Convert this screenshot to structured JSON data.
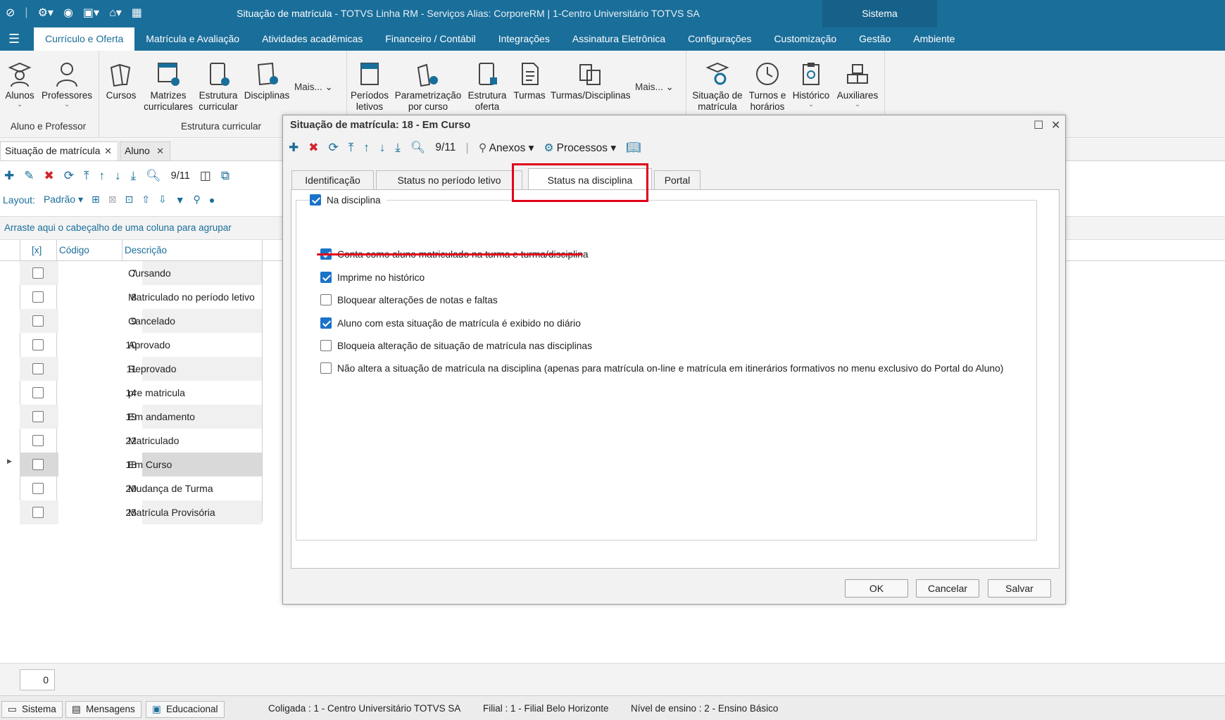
{
  "titlebar": {
    "title_main": "Situação de matrícula",
    "title_rest": " - TOTVS Linha RM - Serviços  Alias: CorporeRM | 1-Centro Universitário TOTVS SA",
    "sistema": "Sistema"
  },
  "menu": {
    "tabs": [
      "Currículo e Oferta",
      "Matrícula e Avaliação",
      "Atividades acadêmicas",
      "Financeiro / Contábil",
      "Integrações",
      "Assinatura Eletrônica",
      "Configurações",
      "Customização",
      "Gestão",
      "Ambiente"
    ]
  },
  "ribbon": {
    "alunos": "Alunos",
    "professores": "Professores",
    "cursos": "Cursos",
    "matrizes": "Matrizes curriculares",
    "estrutura_curricular": "Estrutura curricular",
    "disciplinas": "Disciplinas",
    "mais1": "Mais...",
    "periodos": "Períodos letivos",
    "parametrizacao": "Parametrização por curso",
    "estrutura_oferta": "Estrutura oferta",
    "turmas": "Turmas",
    "turmas_disciplinas": "Turmas/Disciplinas",
    "mais2": "Mais...",
    "situacao": "Situação de matrícula",
    "turnos": "Turnos e horários",
    "historico": "Histórico",
    "auxiliares": "Auxiliares",
    "group1": "Aluno e Professor",
    "group2": "Estrutura curricular"
  },
  "doctabs": {
    "tab1": "Situação de matrícula",
    "tab2": "Aluno"
  },
  "lefttoolbar": {
    "counter": "9/11",
    "layout_label": "Layout:",
    "layout_value": "Padrão"
  },
  "groupbar": {
    "text": "Arraste aqui o cabeçalho de uma coluna para agrupar"
  },
  "grid": {
    "headers": {
      "check": "[x]",
      "code": "Código",
      "desc": "Descrição"
    },
    "rows": [
      {
        "code": "7",
        "desc": "Cursando"
      },
      {
        "code": "8",
        "desc": "Matriculado no período letivo"
      },
      {
        "code": "9",
        "desc": "Cancelado"
      },
      {
        "code": "10",
        "desc": "Aprovado"
      },
      {
        "code": "11",
        "desc": "Reprovado"
      },
      {
        "code": "14",
        "desc": "pre matricula"
      },
      {
        "code": "19",
        "desc": "Em andamento"
      },
      {
        "code": "22",
        "desc": "Matriculado"
      },
      {
        "code": "18",
        "desc": "Em Curso"
      },
      {
        "code": "20",
        "desc": "Mudança de Turma"
      },
      {
        "code": "25",
        "desc": "Matrícula Provisória"
      }
    ]
  },
  "pager": {
    "value": "0"
  },
  "statusbar": {
    "sistema": "Sistema",
    "mensagens": "Mensagens",
    "educacional": "Educacional",
    "coligada": "Coligada : 1 - Centro Universitário TOTVS SA",
    "filial": "Filial : 1 - Filial Belo Horizonte",
    "nivel": "Nível de ensino : 2 - Ensino Básico"
  },
  "dialog": {
    "title": "Situação de matrícula: 18 - Em Curso",
    "counter": "9/11",
    "anexos": "Anexos",
    "processos": "Processos",
    "tabs": [
      "Identificação",
      "Status no período letivo",
      "Status na disciplina",
      "Portal"
    ],
    "fieldset_label": "Na disciplina",
    "options": [
      {
        "label": "Conta como aluno matriculado na turma e turma/disciplina",
        "checked": true
      },
      {
        "label": "Imprime no histórico",
        "checked": true
      },
      {
        "label": "Bloquear alterações de notas e faltas",
        "checked": false
      },
      {
        "label": "Aluno com esta situação de matrícula é exibido no diário",
        "checked": true
      },
      {
        "label": "Bloqueia alteração de situação de matrícula nas disciplinas",
        "checked": false
      },
      {
        "label": "Não altera a situação de matrícula na disciplina (apenas para matrícula on-line e matrícula em itinerários formativos no menu exclusivo do Portal do Aluno)",
        "checked": false
      }
    ],
    "ok": "OK",
    "cancelar": "Cancelar",
    "salvar": "Salvar"
  },
  "colors": {
    "brand": "#1a6e9a",
    "highlight": "#e0001b",
    "check": "#1a73c9"
  }
}
